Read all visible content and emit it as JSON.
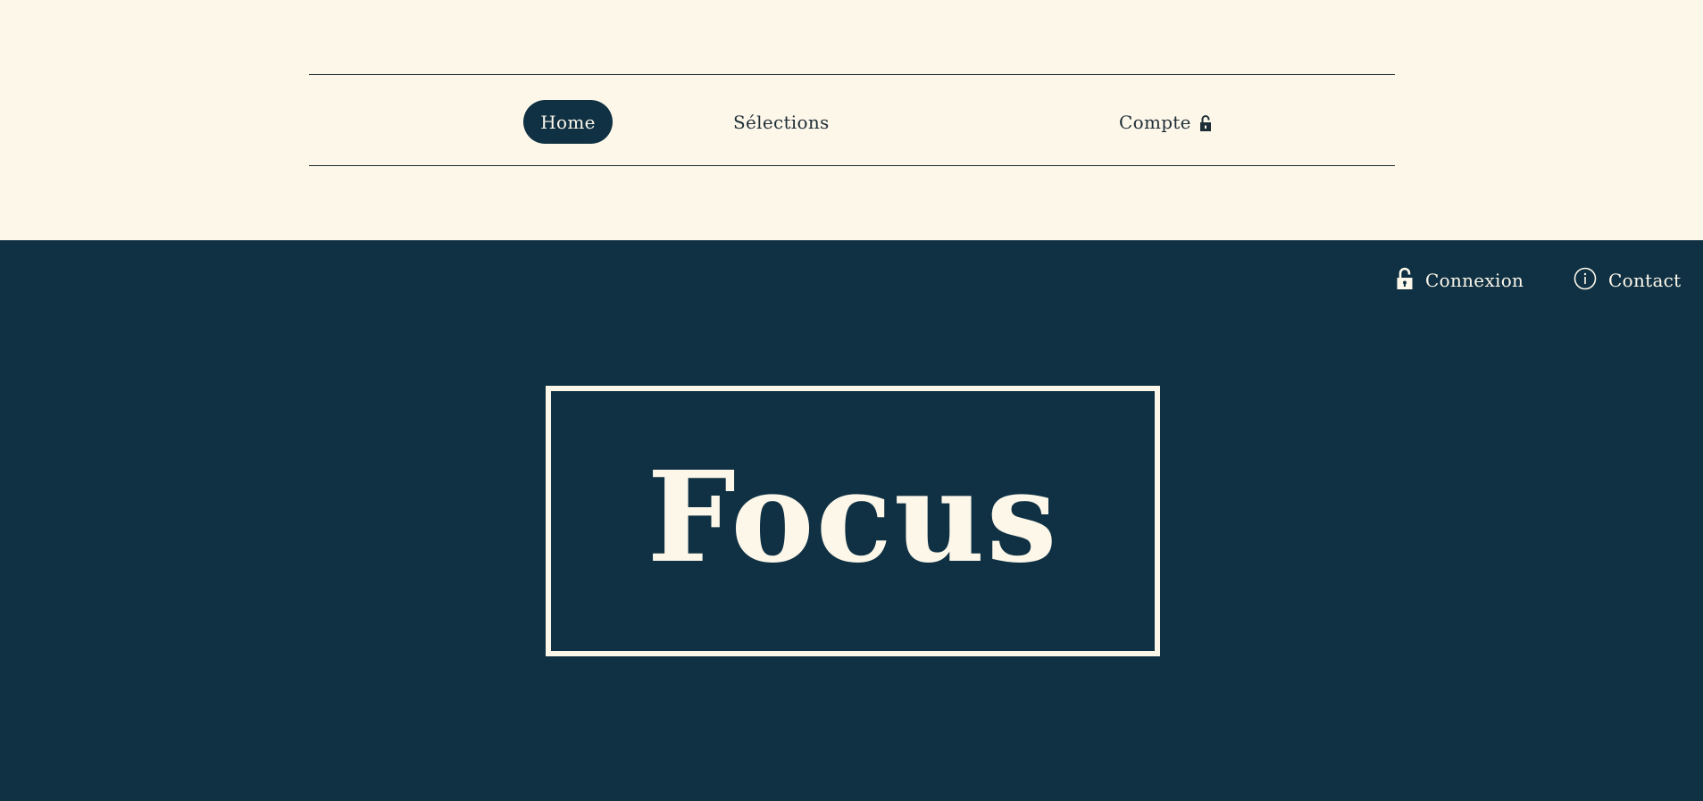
{
  "nav": {
    "items": [
      {
        "label": "Home",
        "active": true
      },
      {
        "label": "Sélections",
        "active": false
      },
      {
        "label": "Compte",
        "icon": "lock-open-icon",
        "active": false
      }
    ]
  },
  "utility": {
    "login_label": "Connexion",
    "login_icon": "lock-open-icon",
    "contact_label": "Contact",
    "contact_icon": "info-icon"
  },
  "hero": {
    "title": "Focus"
  },
  "colors": {
    "cream": "#fdf7ea",
    "navy": "#0f3143",
    "text_dark": "#1f2e36"
  }
}
